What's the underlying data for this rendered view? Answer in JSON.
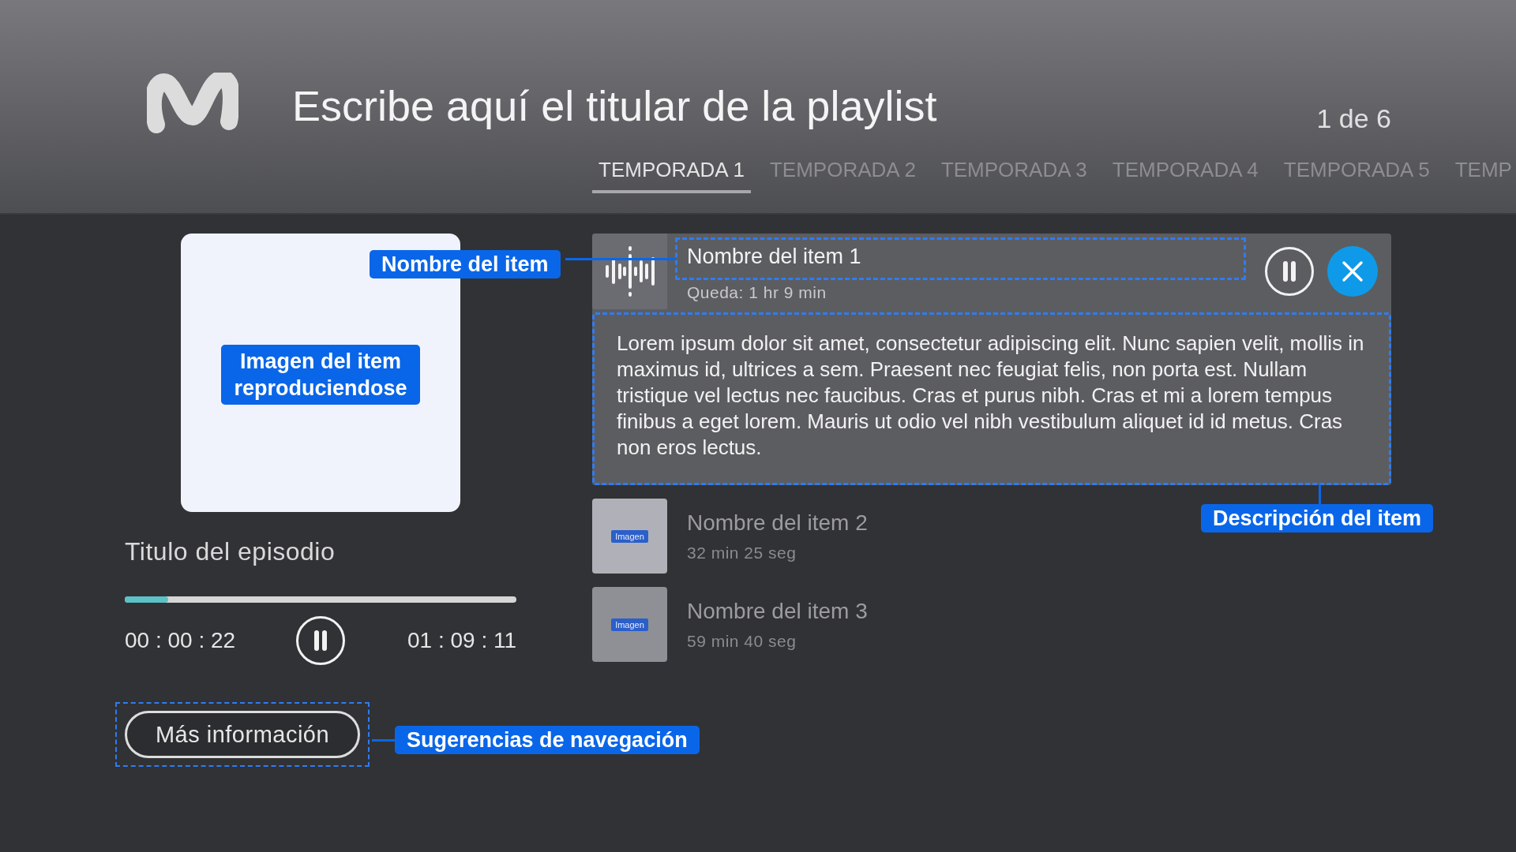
{
  "header": {
    "title": "Escribe aquí el titular de la playlist",
    "counter": "1 de 6"
  },
  "tabs": [
    {
      "label": "TEMPORADA 1",
      "selected": true
    },
    {
      "label": "TEMPORADA 2",
      "selected": false
    },
    {
      "label": "TEMPORADA 3",
      "selected": false
    },
    {
      "label": "TEMPORADA 4",
      "selected": false
    },
    {
      "label": "TEMPORADA 5",
      "selected": false
    },
    {
      "label": "TEMP",
      "selected": false
    }
  ],
  "player": {
    "episode_title": "Titulo del episodio",
    "level": 0.11,
    "elapsed": "00 : 00 : 22",
    "total": "01 : 09 : 11",
    "more_button": "Más información"
  },
  "playlist": [
    {
      "name": "Nombre del item 1",
      "meta": "Queda: 1 hr 9 min",
      "selected": true,
      "description": "Lorem ipsum dolor sit amet, consectetur adipiscing elit. Nunc sapien velit, mollis in maximus id, ultrices a sem. Praesent nec feugiat felis, non porta est. Nullam tristique vel lectus nec faucibus. Cras et purus nibh. Cras et mi a lorem tempus finibus a eget lorem. Mauris ut odio vel nibh vestibulum aliquet id id metus. Cras non eros lectus."
    },
    {
      "name": "Nombre del item 2",
      "meta": "32 min 25 seg",
      "selected": false,
      "thumb_label": "Imagen"
    },
    {
      "name": "Nombre del item 3",
      "meta": "59 min 40 seg",
      "selected": false,
      "thumb_label": "Imagen"
    }
  ],
  "annotations": [
    {
      "text": "Nombre del item"
    },
    {
      "text": "Imagen del item reproduciendose"
    },
    {
      "text": "Descripción del item"
    },
    {
      "text": "Sugerencias de navegación"
    }
  ]
}
